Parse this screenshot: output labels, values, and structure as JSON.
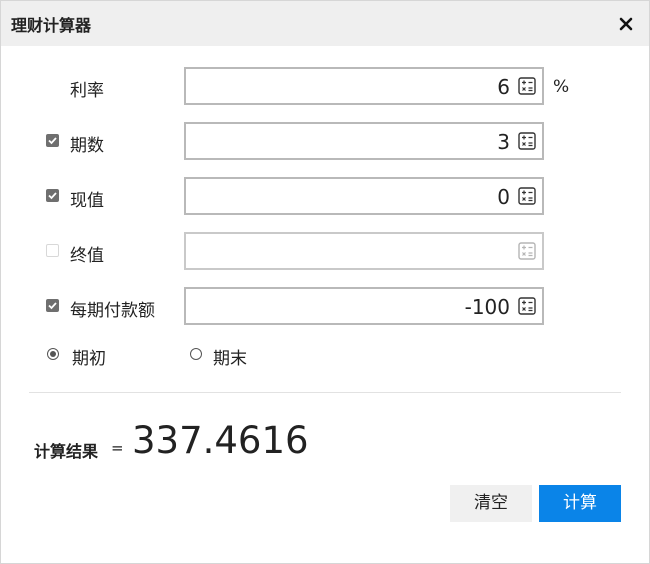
{
  "dialog": {
    "title": "理财计算器"
  },
  "fields": {
    "rate": {
      "label": "利率",
      "value": "6",
      "unit": "%"
    },
    "periods": {
      "label": "期数",
      "value": "3",
      "checked": true
    },
    "present_value": {
      "label": "现值",
      "value": "0",
      "checked": true
    },
    "future_value": {
      "label": "终值",
      "value": "",
      "checked": false
    },
    "payment": {
      "label": "每期付款额",
      "value": "-100",
      "checked": true
    }
  },
  "timing": {
    "begin_label": "期初",
    "end_label": "期末",
    "selected": "begin"
  },
  "result": {
    "label": "计算结果",
    "equals": "=",
    "value": "337.4616"
  },
  "buttons": {
    "clear": "清空",
    "calculate": "计算"
  },
  "colors": {
    "primary": "#0a84e8",
    "titlebar": "#efefef",
    "checkbox": "#6f6f6f"
  }
}
